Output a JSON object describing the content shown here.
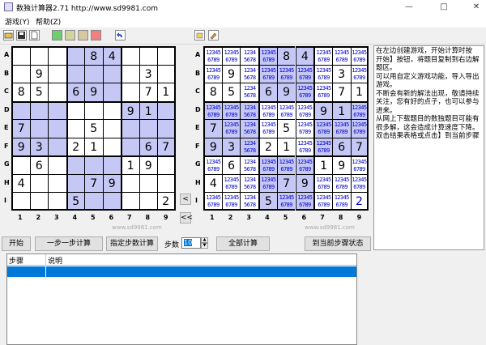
{
  "window": {
    "title": "数独计算器2.71 http://www.sd9981.com"
  },
  "menu": [
    "游戏(Y)",
    "帮助(Z)"
  ],
  "toolbar": {
    "icons": [
      "open-icon",
      "save-icon",
      "new-icon",
      "color-green",
      "color-khaki",
      "color-tan",
      "color-red",
      "undo-icon"
    ],
    "right_icons": [
      "clear-icon",
      "edit-icon"
    ]
  },
  "row_labels": [
    "A",
    "B",
    "C",
    "D",
    "E",
    "F",
    "G",
    "H",
    "I"
  ],
  "col_labels": [
    "1",
    "2",
    "3",
    "4",
    "5",
    "6",
    "7",
    "8",
    "9"
  ],
  "colors": {
    "shade": "#c5c8f5",
    "grid": "#000000",
    "given": "#000000",
    "candidate": "#0000cc",
    "highlight_blue": "#0078d7"
  },
  "board": [
    [
      "",
      "",
      "",
      "",
      "8",
      "4",
      "",
      "",
      ""
    ],
    [
      "",
      "9",
      "",
      "",
      "",
      "",
      "",
      "3",
      ""
    ],
    [
      "8",
      "5",
      "",
      "6",
      "9",
      "",
      "",
      "7",
      "1"
    ],
    [
      "",
      "",
      "",
      "",
      "",
      "",
      "9",
      "1",
      ""
    ],
    [
      "7",
      "",
      "",
      "",
      "5",
      "",
      "",
      "",
      ""
    ],
    [
      "9",
      "3",
      "",
      "2",
      "1",
      "",
      "",
      "6",
      "7"
    ],
    [
      "",
      "6",
      "",
      "",
      "",
      "",
      "1",
      "9",
      ""
    ],
    [
      "4",
      "",
      "",
      "",
      "7",
      "9",
      "",
      "",
      ""
    ],
    [
      "",
      "",
      "",
      "5",
      "",
      "",
      "",
      "",
      "2"
    ]
  ],
  "right_special": {
    "cell": "I9",
    "value": "2",
    "color": "#0000cc"
  },
  "candidate_text": {
    "line1": "12345",
    "line2": "6789"
  },
  "candidate_narrow": {
    "line1": "1234",
    "line2": "5678"
  },
  "watermark": "www.sd9981.com",
  "nav_buttons": [
    "<",
    "<<"
  ],
  "buttons": {
    "start": "开始",
    "step": "一步一步计算",
    "specified": "指定步数计算",
    "steps_label": "步数",
    "steps_value": "10",
    "all": "全部计算",
    "to_current": "到当前步骤状态"
  },
  "instructions": [
    "在左边创建游戏，开始计算时按",
    "开始】按钮，将题目复制到右边解",
    "题区。",
    "可以用自定义游戏功能，导入导出游戏。",
    "不断会有新的解法出现，敬请持续关注，您有好的点子，也可以参与进来。",
    "从网上下载题目的数独题目可能有很多解，这会造成计算速度下降。",
    "双击结果表格或点击】到当前步骤"
  ],
  "log_table": {
    "headers": [
      "步骤",
      "说明"
    ]
  }
}
